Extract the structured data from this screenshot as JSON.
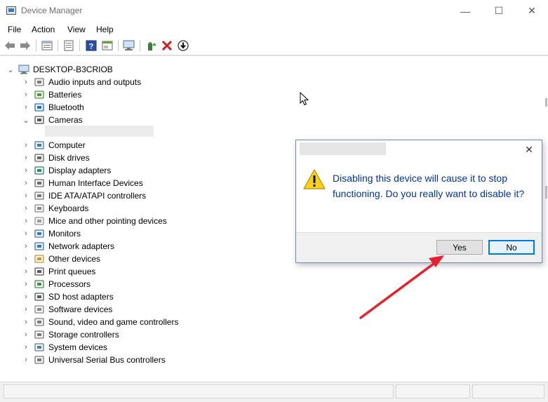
{
  "window": {
    "title": "Device Manager",
    "minimize_glyph": "—",
    "maximize_glyph": "☐",
    "close_glyph": "✕"
  },
  "menu": [
    "File",
    "Action",
    "View",
    "Help"
  ],
  "toolbar": {
    "icons": [
      "back-icon",
      "forward-icon",
      "properties-icon",
      "show-hidden-icon",
      "help-icon",
      "action-icon",
      "scan-hardware-icon",
      "update-driver-icon",
      "uninstall-icon",
      "disable-device-icon"
    ]
  },
  "tree": {
    "root": "DESKTOP-B3CRIOB",
    "categories": [
      {
        "label": "Audio inputs and outputs",
        "expanded": false
      },
      {
        "label": "Batteries",
        "expanded": false
      },
      {
        "label": "Bluetooth",
        "expanded": false
      },
      {
        "label": "Cameras",
        "expanded": true
      },
      {
        "label": "Computer",
        "expanded": false
      },
      {
        "label": "Disk drives",
        "expanded": false
      },
      {
        "label": "Display adapters",
        "expanded": false
      },
      {
        "label": "Human Interface Devices",
        "expanded": false
      },
      {
        "label": "IDE ATA/ATAPI controllers",
        "expanded": false
      },
      {
        "label": "Keyboards",
        "expanded": false
      },
      {
        "label": "Mice and other pointing devices",
        "expanded": false
      },
      {
        "label": "Monitors",
        "expanded": false
      },
      {
        "label": "Network adapters",
        "expanded": false
      },
      {
        "label": "Other devices",
        "expanded": false
      },
      {
        "label": "Print queues",
        "expanded": false
      },
      {
        "label": "Processors",
        "expanded": false
      },
      {
        "label": "SD host adapters",
        "expanded": false
      },
      {
        "label": "Software devices",
        "expanded": false
      },
      {
        "label": "Sound, video and game controllers",
        "expanded": false
      },
      {
        "label": "Storage controllers",
        "expanded": false
      },
      {
        "label": "System devices",
        "expanded": false
      },
      {
        "label": "Universal Serial Bus controllers",
        "expanded": false
      }
    ]
  },
  "dialog": {
    "message": "Disabling this device will cause it to stop functioning. Do you really want to disable it?",
    "yes_label": "Yes",
    "no_label": "No",
    "close_glyph": "✕",
    "icon": "warning-icon"
  },
  "colors": {
    "dialog_text": "#003399",
    "annotation_arrow": "#e8202a",
    "default_button_border": "#0078d7",
    "warning_yellow": "#f8d31a"
  }
}
